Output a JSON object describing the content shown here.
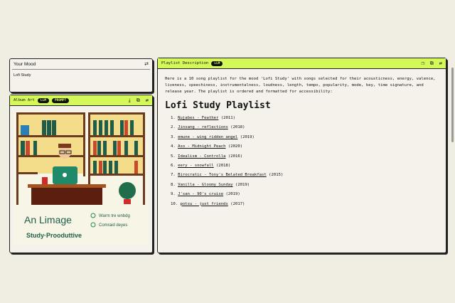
{
  "mood": {
    "title": "Your Mood",
    "value": "Lofi Study",
    "icon": "sliders-icon"
  },
  "album_art": {
    "title": "Album Art",
    "badges": [
      "LLM",
      "PROMPT"
    ],
    "image_text": {
      "line1": "An Limage",
      "line2": "Study·Prooduttive",
      "check1": "Warm tre wnbdg",
      "check2": "Comraid deyes"
    }
  },
  "playlist": {
    "title": "Playlist Description",
    "badge": "LLM",
    "intro": "Here is a 10 song playlist for the mood 'Lofi Study' with songs selected for their acousticness, energy, valence, liveness, speechiness, instrumentalness, loudness, length, tempo, popularity, mode, key, time signature, and release year. The playlist is ordered and formatted for accessibility:",
    "heading": "Lofi Study Playlist",
    "songs": [
      {
        "n": "1.",
        "title": "Nujabes - Feather",
        "year": "(2011)"
      },
      {
        "n": "2.",
        "title": "Jinsang - reflections",
        "year": "(2018)"
      },
      {
        "n": "3.",
        "title": "emune - wing ridden angel",
        "year": "(2019)"
      },
      {
        "n": "4.",
        "title": "Aso - Midnight Peach",
        "year": "(2020)"
      },
      {
        "n": "5.",
        "title": "Idealism - Controlla",
        "year": "(2016)"
      },
      {
        "n": "6.",
        "title": "eery - snowfall",
        "year": "(2018)"
      },
      {
        "n": "7.",
        "title": "Birocratic - Tony's Belated Breakfast",
        "year": "(2015)"
      },
      {
        "n": "8.",
        "title": "Vanilla - Gloomy Sunday",
        "year": "(2019)"
      },
      {
        "n": "9.",
        "title": "J'san - 90's cruise",
        "year": "(2019)"
      },
      {
        "n": "10.",
        "title": "potsu - just friends",
        "year": "(2017)"
      }
    ]
  },
  "colors": {
    "accent": "#d4f75a",
    "dark": "#111111"
  }
}
